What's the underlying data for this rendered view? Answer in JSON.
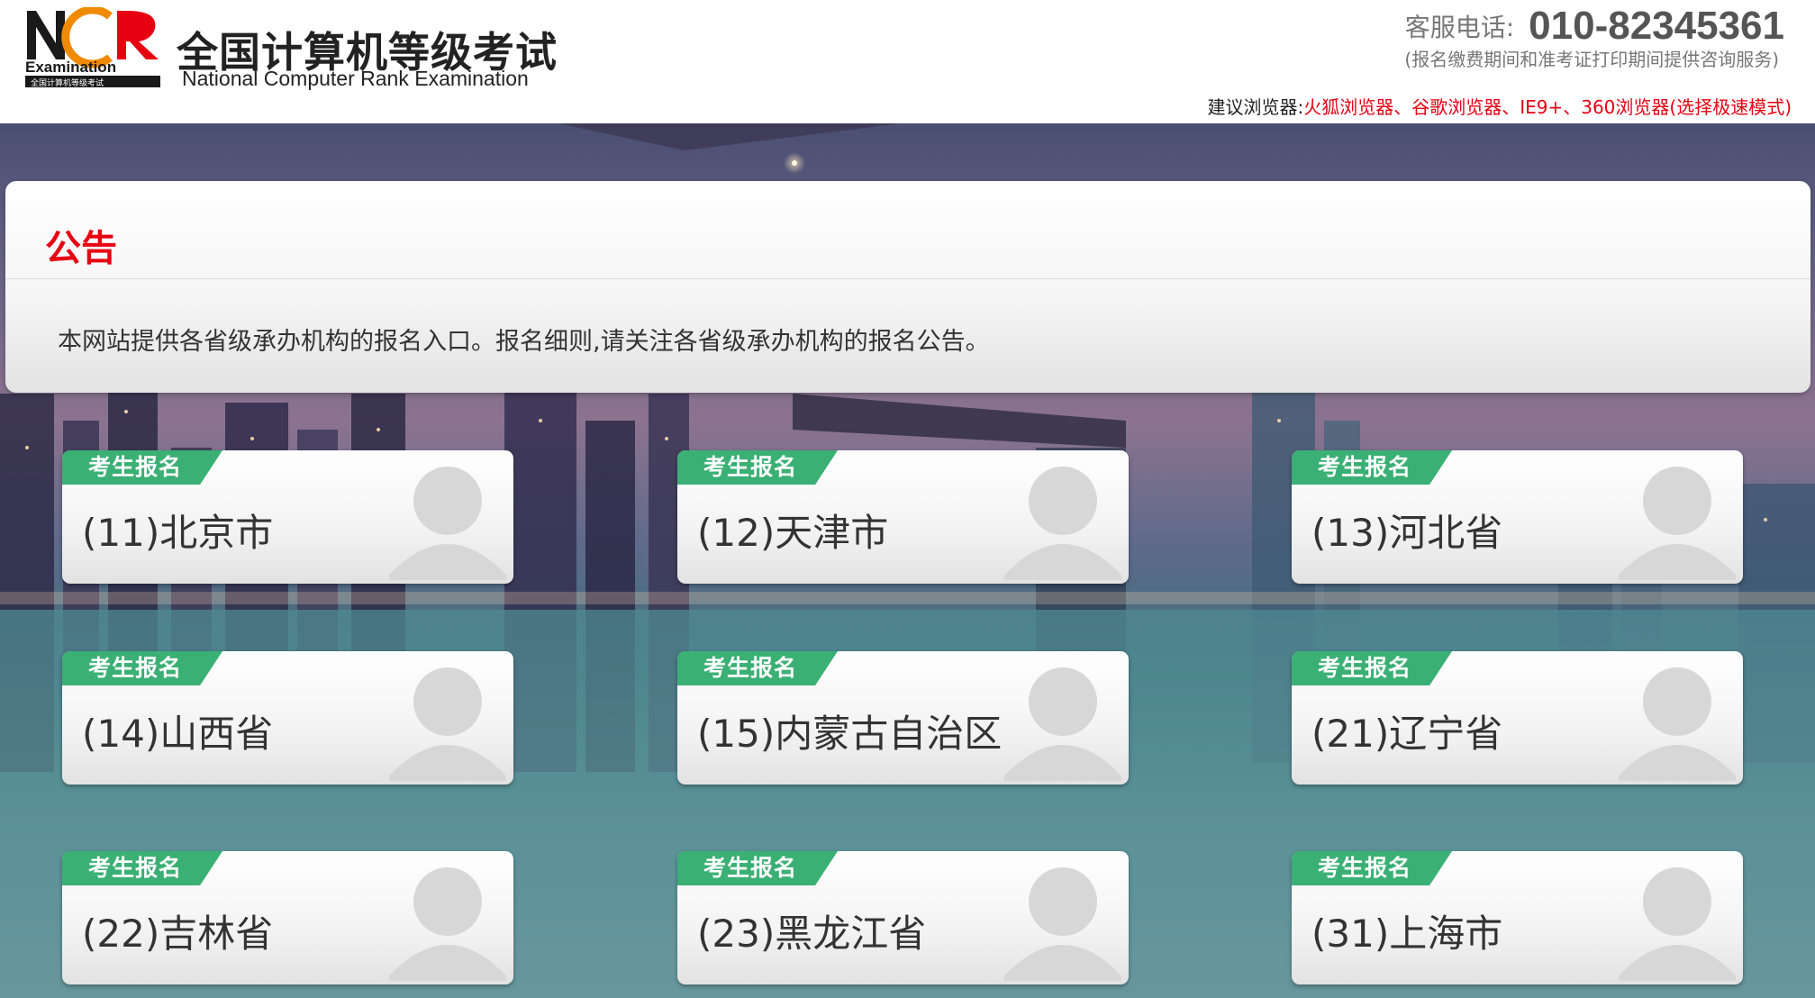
{
  "header": {
    "logo_text": "Examination",
    "logo_small_text": "全国计算机等级考试",
    "title": "全国计算机等级考试",
    "subtitle": "National Computer Rank Examination",
    "hotline_label": "客服电话:",
    "hotline_number": "010-82345361",
    "hotline_note": "(报名缴费期间和准考证打印期间提供咨询服务)",
    "browser_tip_label": "建议浏览器:",
    "browser_tip_value": "火狐浏览器、谷歌浏览器、IE9+、360浏览器(选择极速模式)"
  },
  "notice": {
    "title": "公告",
    "body": "本网站提供各省级承办机构的报名入口。报名细则,请关注各省级承办机构的报名公告。"
  },
  "cards": [
    {
      "badge": "考生报名",
      "name": "(11)北京市"
    },
    {
      "badge": "考生报名",
      "name": "(12)天津市"
    },
    {
      "badge": "考生报名",
      "name": "(13)河北省"
    },
    {
      "badge": "考生报名",
      "name": "(14)山西省"
    },
    {
      "badge": "考生报名",
      "name": "(15)内蒙古自治区"
    },
    {
      "badge": "考生报名",
      "name": "(21)辽宁省"
    },
    {
      "badge": "考生报名",
      "name": "(22)吉林省"
    },
    {
      "badge": "考生报名",
      "name": "(23)黑龙江省"
    },
    {
      "badge": "考生报名",
      "name": "(31)上海市"
    }
  ],
  "colors": {
    "accent_red": "#e60012",
    "badge_green": "#3ab074"
  }
}
